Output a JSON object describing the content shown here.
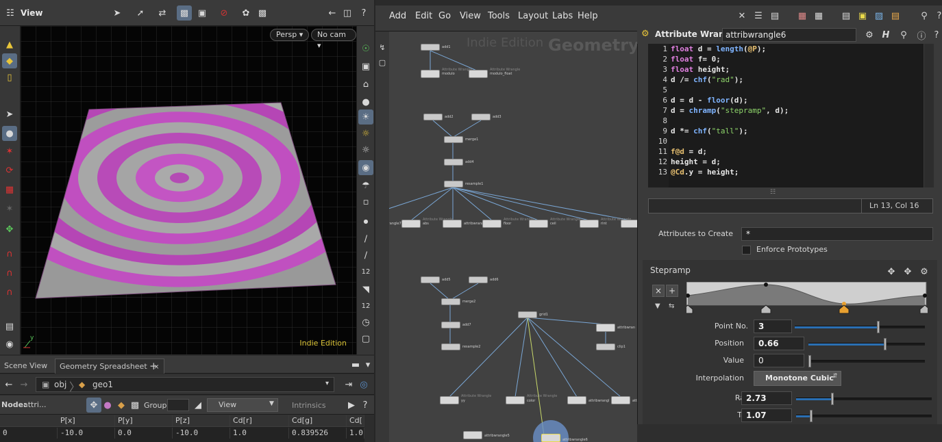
{
  "viewport": {
    "title": "View",
    "camera": "Persp",
    "cam_select": "No cam",
    "watermark": "Indie Edition",
    "axis_y": "y"
  },
  "tabs": [
    {
      "label": "Scene View"
    },
    {
      "label": "Geometry Spreadsheet"
    },
    {
      "label": "+"
    }
  ],
  "path": {
    "root": "obj",
    "node": "geo1"
  },
  "spreadsheet": {
    "node_label": "Node:",
    "node_value": "attri...",
    "group_label": "Group:",
    "view_label": "View",
    "intrinsics_label": "Intrinsics",
    "columns": [
      "P[x]",
      "P[y]",
      "P[z]",
      "Cd[r]",
      "Cd[g]",
      "Cd["
    ],
    "rows": [
      {
        "index": "0",
        "cells": [
          "-10.0",
          "0.0",
          "-10.0",
          "1.0",
          "0.839526",
          "1.0"
        ]
      }
    ]
  },
  "menubar": {
    "items": [
      "Add",
      "Edit",
      "Go",
      "View",
      "Tools",
      "Layout",
      "Labs",
      "Help"
    ]
  },
  "network": {
    "watermark_edition": "Indie Edition",
    "watermark_context": "Geometry",
    "nodes": [
      {
        "label": "add1",
        "sublabel": ""
      },
      {
        "label": "modulo",
        "sublabel": "Attribute Wrangle"
      },
      {
        "label": "modulo_float",
        "sublabel": "Attribute Wrangle"
      },
      {
        "label": "add2",
        "sublabel": ""
      },
      {
        "label": "add3",
        "sublabel": ""
      },
      {
        "label": "merge1",
        "sublabel": ""
      },
      {
        "label": "add4",
        "sublabel": ""
      },
      {
        "label": "resample1",
        "sublabel": ""
      },
      {
        "label": "tribwrangle7",
        "sublabel": ""
      },
      {
        "label": "abs",
        "sublabel": "Attribute Wrangle"
      },
      {
        "label": "attribwrangle",
        "sublabel": ""
      },
      {
        "label": "floor",
        "sublabel": "Attribute Wrangle"
      },
      {
        "label": "ceil",
        "sublabel": "Attribute Wrangle"
      },
      {
        "label": "rint",
        "sublabel": "Attribute Wrangle"
      },
      {
        "label": "add5",
        "sublabel": ""
      },
      {
        "label": "add6",
        "sublabel": ""
      },
      {
        "label": "merge2",
        "sublabel": ""
      },
      {
        "label": "add7",
        "sublabel": ""
      },
      {
        "label": "resample2",
        "sublabel": ""
      },
      {
        "label": "grid1",
        "sublabel": ""
      },
      {
        "label": "attribwran",
        "sublabel": ""
      },
      {
        "label": "clip1",
        "sublabel": ""
      },
      {
        "label": "yy",
        "sublabel": "Attribute Wrangle"
      },
      {
        "label": "color",
        "sublabel": "Attribute Wrangle"
      },
      {
        "label": "attribwrangl",
        "sublabel": ""
      },
      {
        "label": "att",
        "sublabel": ""
      },
      {
        "label": "attribwrangle5",
        "sublabel": ""
      },
      {
        "label": "attribwrangle6",
        "sublabel": ""
      }
    ]
  },
  "params": {
    "node_type": "Attribute Wrangle",
    "node_name": "attribwrangle6",
    "code_lines": [
      "float d = length(@P);",
      "float f= 0;",
      "float height;",
      "d /= chf(\"rad\");",
      "",
      "d = d - floor(d);",
      "d = chramp(\"stepramp\", d);",
      "",
      "d *= chf(\"tall\");",
      "",
      "f@d = d;",
      "height = d;",
      "@Cd.y = height;"
    ],
    "cursor_status": "Ln 13, Col 16",
    "attributes_to_create_label": "Attributes to Create",
    "attributes_to_create_value": "*",
    "enforce_prototypes_label": "Enforce Prototypes",
    "ramp_title": "Stepramp",
    "point_no_label": "Point No.",
    "point_no_value": "3",
    "point_no_level": 0.64,
    "position_label": "Position",
    "position_value": "0.66",
    "position_level": 0.66,
    "value_label": "Value",
    "value_value": "0",
    "value_level": 0,
    "interpolation_label": "Interpolation",
    "interpolation_value": "Monotone Cubic",
    "rad_label": "Rad",
    "rad_value": "2.73",
    "rad_level": 0.27,
    "tall_label": "Tall",
    "tall_value": "1.07",
    "tall_level": 0.11
  },
  "colors": {
    "accent": "#2a6fb3",
    "watermark": "#d9c235",
    "ripple_magenta": "#b03cb0",
    "ripple_grey": "#8e8e8e"
  }
}
